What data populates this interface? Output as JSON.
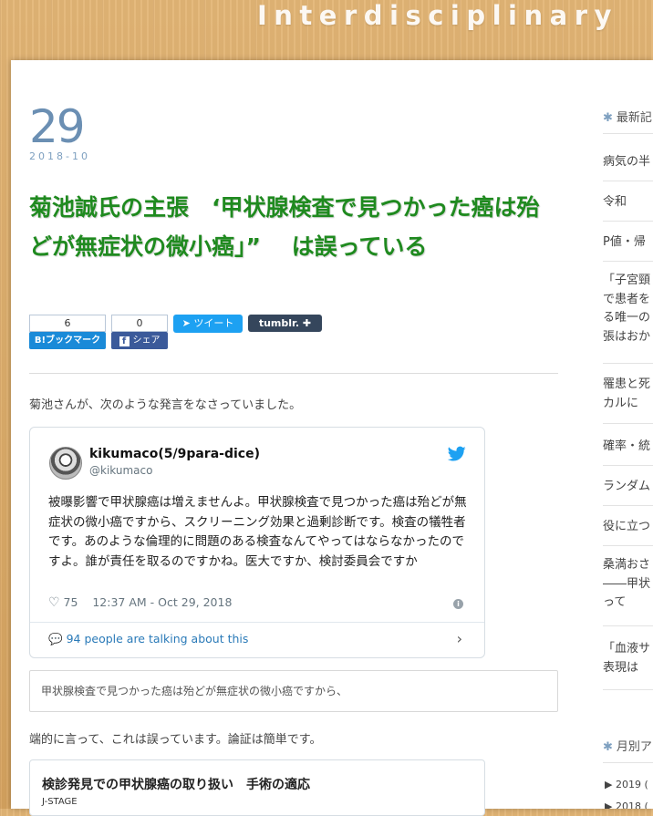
{
  "site": {
    "title": "Interdisciplinary"
  },
  "entry": {
    "day": "29",
    "year_month": "2018-10",
    "title": "菊池誠氏の主張　‘甲状腺検査で見つかった癌は殆どが無症状の微小癌」” 　は誤っている",
    "intro": "菊池さんが、次のような発言をなさっていました。",
    "quote": "甲状腺検査で見つかった癌は殆どが無症状の微小癌ですから、",
    "after_quote": "端的に言って、これは誤っています。論証は簡単です。"
  },
  "share": {
    "hatena_count": "6",
    "hatena_label": "B!ブックマーク",
    "facebook_count": "0",
    "facebook_label": "シェア",
    "tweet_label": "ツイート",
    "tumblr_label": "tumblr."
  },
  "tweet": {
    "name": "kikumaco(5/9para-dice)",
    "handle": "@kikumaco",
    "text": "被曝影響で甲状腺癌は増えませんよ。甲状腺検査で見つかった癌は殆どが無症状の微小癌ですから、スクリーニング効果と過剰診断です。検査の犠牲者です。あのような倫理的に問題のある検査なんてやってはならなかったのですよ。誰が責任を取るのですかね。医大ですか、検討委員会ですか",
    "likes": "75",
    "timestamp": "12:37 AM - Oct 29, 2018",
    "talking": "94 people are talking about this"
  },
  "card": {
    "title": "検診発見での甲状腺癌の取り扱い　手術の適応",
    "source": "J-STAGE"
  },
  "sidebar": {
    "recent_heading": "最新記",
    "recent_items": [
      "病気の半",
      "令和",
      "P値・帰",
      "「子宮頸\nで患者を\nる唯一の\n張はおか",
      "罹患と死\nカルに",
      "確率・統",
      "ランダム",
      "役に立つ",
      "桑満おさ\n――甲状\nって",
      "「血液サ\n表現は"
    ],
    "monthly_heading": "月別ア",
    "archive": [
      "▶ 2019 (",
      "▶ 2018 ("
    ]
  },
  "colors": {
    "title_green": "#1f8a1f",
    "date_blue": "#6b8fb3",
    "twitter_blue": "#1da1f2",
    "hatena_blue": "#1a8ad8",
    "facebook_blue": "#3b5a9a",
    "tumblr_navy": "#35465c"
  }
}
